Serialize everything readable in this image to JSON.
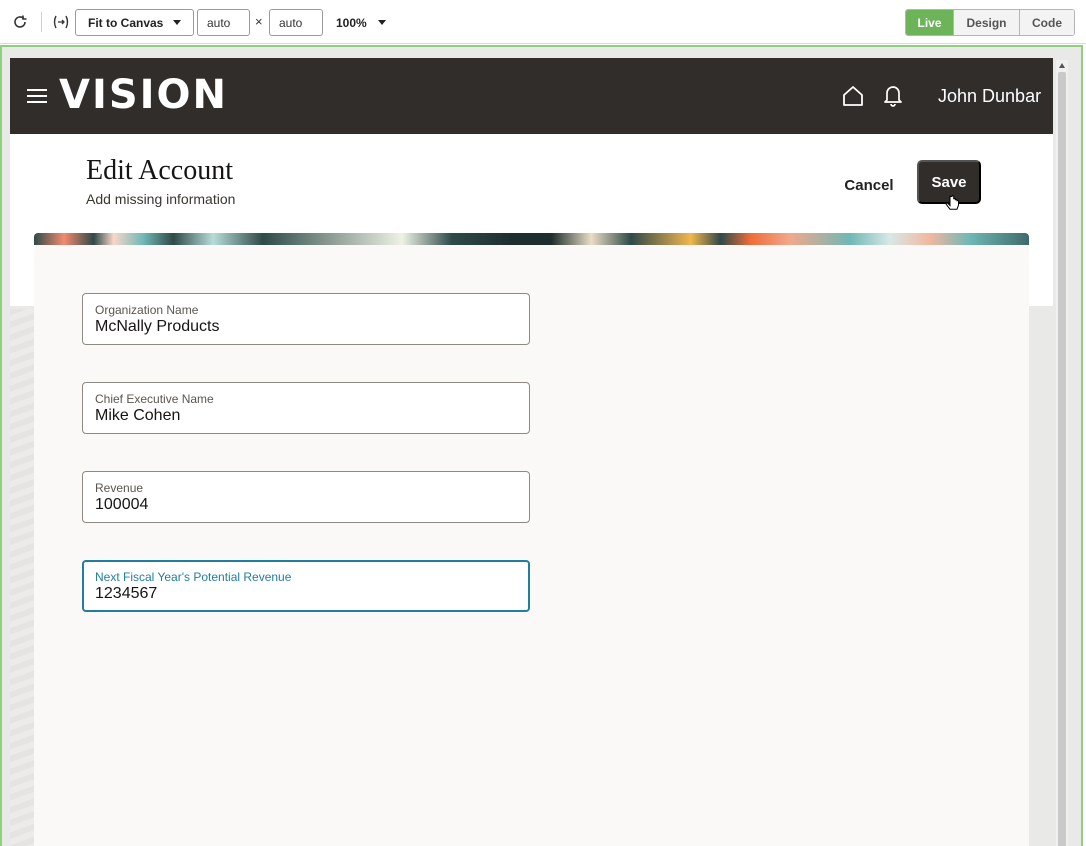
{
  "toolbar": {
    "fit_select": "Fit to Canvas",
    "width_value": "auto",
    "times": "×",
    "height_value": "auto",
    "zoom": "100%",
    "modes": [
      "Live",
      "Design",
      "Code"
    ],
    "active_mode": "Live",
    "active_color": "#6cb35a"
  },
  "app": {
    "logo": "VISION",
    "user_name": "John Dunbar",
    "header_color": "#312d2a"
  },
  "page": {
    "title": "Edit Account",
    "subtitle": "Add missing information",
    "cancel_label": "Cancel",
    "save_label": "Save"
  },
  "form": {
    "fields": [
      {
        "label": "Organization Name",
        "value": "McNally Products"
      },
      {
        "label": "Chief Executive Name",
        "value": "Mike Cohen"
      },
      {
        "label": "Revenue",
        "value": "100004"
      },
      {
        "label": "Next Fiscal Year's Potential Revenue",
        "value": "1234567"
      }
    ],
    "focused_field": "Next Fiscal Year's Potential Revenue",
    "focus_color": "#227e9e"
  }
}
